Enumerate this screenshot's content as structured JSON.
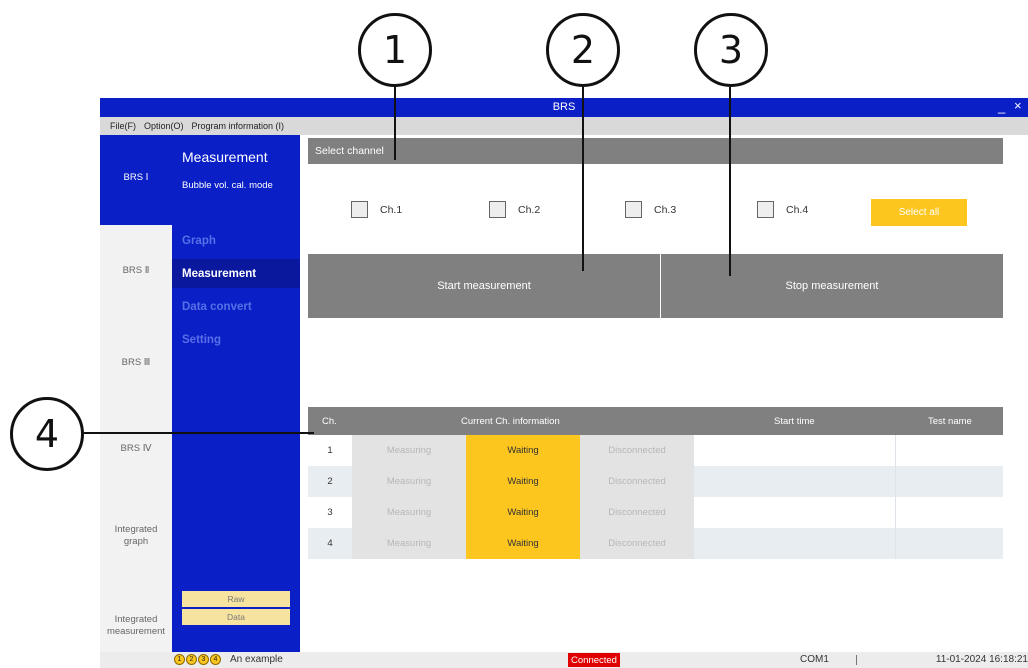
{
  "callouts": [
    "1",
    "2",
    "3",
    "4"
  ],
  "window": {
    "title": "BRS",
    "minimize_glyph": "_",
    "close_glyph": "×"
  },
  "menu": {
    "file": "File(F)",
    "option": "Option(O)",
    "program_info": "Program information (I)"
  },
  "left_nav": {
    "items": [
      {
        "label": "BRS Ⅰ",
        "active": true
      },
      {
        "label": "BRS Ⅱ",
        "active": false
      },
      {
        "label": "BRS Ⅲ",
        "active": false
      },
      {
        "label": "BRS Ⅳ",
        "active": false
      },
      {
        "label": "Integrated\ngraph",
        "active": false
      },
      {
        "label": "Integrated\nmeasurement",
        "active": false
      }
    ]
  },
  "sub_panel": {
    "heading": "Measurement",
    "mode": "Bubble vol. cal. mode",
    "items": [
      {
        "label": "Graph",
        "active": false
      },
      {
        "label": "Measurement",
        "active": true
      },
      {
        "label": "Data convert",
        "active": false
      },
      {
        "label": "Setting",
        "active": false
      }
    ],
    "raw_label": "Raw",
    "data_label": "Data"
  },
  "channels": {
    "section_title": "Select channel",
    "items": [
      "Ch.1",
      "Ch.2",
      "Ch.3",
      "Ch.4"
    ],
    "select_all": "Select all"
  },
  "actions": {
    "start": "Start measurement",
    "stop": "Stop measurement"
  },
  "table": {
    "headers": {
      "ch": "Ch.",
      "info": "Current Ch. information",
      "start_time": "Start time",
      "test_name": "Test name"
    },
    "rows": [
      {
        "num": "1",
        "measuring": "Measuring",
        "waiting": "Waiting",
        "disconnected": "Disconnected"
      },
      {
        "num": "2",
        "measuring": "Measuring",
        "waiting": "Waiting",
        "disconnected": "Disconnected"
      },
      {
        "num": "3",
        "measuring": "Measuring",
        "waiting": "Waiting",
        "disconnected": "Disconnected"
      },
      {
        "num": "4",
        "measuring": "Measuring",
        "waiting": "Waiting",
        "disconnected": "Disconnected"
      }
    ]
  },
  "status": {
    "legend_numbers": [
      "1",
      "2",
      "3",
      "4"
    ],
    "example_text": "An example",
    "connection": "Connected",
    "port": "COM1",
    "timestamp": "11-01-2024 16:18:21"
  },
  "colors": {
    "primary_blue": "#0b1fc7",
    "accent_yellow": "#fdc61f",
    "gray_bar": "#808080",
    "connected_red": "#e00000"
  }
}
